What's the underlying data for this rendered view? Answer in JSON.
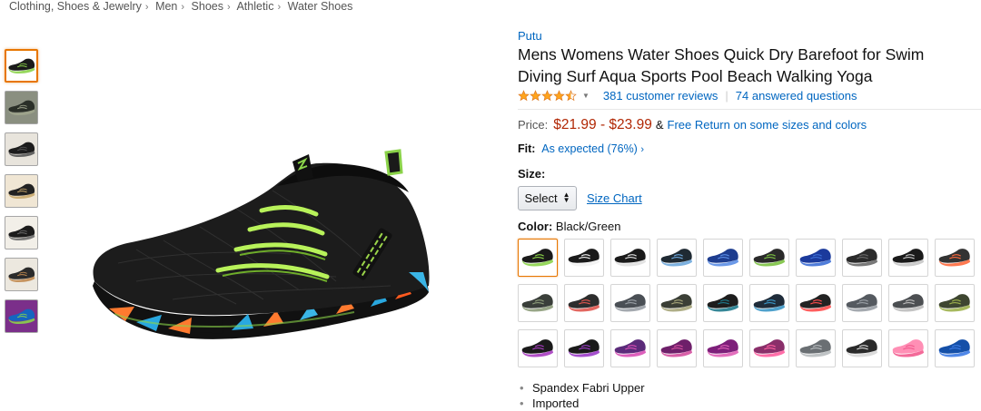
{
  "breadcrumb": [
    "Clothing, Shoes & Jewelry",
    "Men",
    "Shoes",
    "Athletic",
    "Water Shoes"
  ],
  "breadcrumb_separator": "›",
  "product": {
    "brand": "Putu",
    "title": "Mens Womens Water Shoes Quick Dry Barefoot for Swim Diving Surf Aqua Sports Pool Beach Walking Yoga",
    "rating": 4.5,
    "reviews_link": "381 customer reviews",
    "questions_link": "74 answered questions",
    "price_label": "Price:",
    "price_range": "$21.99 - $23.99",
    "amp": "&",
    "free_return": "Free Return on some sizes and colors",
    "fit_label": "Fit:",
    "fit_value": "As expected (76%)",
    "fit_caret": "›",
    "size_label": "Size:",
    "size_select": "Select",
    "size_chart": "Size Chart",
    "color_label": "Color:",
    "color_value": "Black/Green",
    "bullets": [
      "Spandex Fabri Upper",
      "Imported"
    ]
  },
  "colors": {
    "link": "#0066c0",
    "price": "#b12704",
    "selected_border": "#e77600",
    "star": "#ffa41c"
  },
  "thumbnails": [
    {
      "name": "black-green",
      "bg": "#ffffff",
      "shoe": "#1a1a1a",
      "accent": "#8bd34a"
    },
    {
      "name": "grey-scene",
      "bg": "#8a8f80",
      "shoe": "#2a2f28",
      "accent": "#9fa58c"
    },
    {
      "name": "pair",
      "bg": "#e8e4dc",
      "shoe": "#1c1c1c",
      "accent": "#555"
    },
    {
      "name": "features",
      "bg": "#f0e6d4",
      "shoe": "#222",
      "accent": "#c9a86c"
    },
    {
      "name": "detail",
      "bg": "#f2efe8",
      "shoe": "#1b1b1b",
      "accent": "#6c6c6c"
    },
    {
      "name": "sole",
      "bg": "#ece8df",
      "shoe": "#2b2b2b",
      "accent": "#c18a50"
    },
    {
      "name": "collage",
      "bg": "#7b2f8a",
      "shoe": "#1565c0",
      "accent": "#8bd34a"
    }
  ],
  "swatch_colors": [
    [
      "#1a1a1a",
      "#8bd34a"
    ],
    [
      "#1a1a1a",
      "#f2f2f2"
    ],
    [
      "#1a1a1a",
      "#e0e0e0"
    ],
    [
      "#1f2a33",
      "#6fa8dc"
    ],
    [
      "#1e3d8f",
      "#5b8ee6"
    ],
    [
      "#2a2a2a",
      "#7cc243"
    ],
    [
      "#1b3a9c",
      "#3d6fd6"
    ],
    [
      "#2b2b2b",
      "#6a6a6a"
    ],
    [
      "#1a1a1a",
      "#c7c7c7"
    ],
    [
      "#333333",
      "#ff6a3d"
    ],
    [
      "#3a3f3a",
      "#8d9c7a"
    ],
    [
      "#2d2d2d",
      "#e0574f"
    ],
    [
      "#4a4f55",
      "#9aa0a6"
    ],
    [
      "#3b3f36",
      "#a6a57a"
    ],
    [
      "#1d1d1d",
      "#1f7a8c"
    ],
    [
      "#1f2c3a",
      "#3c97c6"
    ],
    [
      "#222222",
      "#ff4d4d"
    ],
    [
      "#555a60",
      "#9aa0a6"
    ],
    [
      "#4c4f52",
      "#bcbcbc"
    ],
    [
      "#3e4630",
      "#9db14d"
    ],
    [
      "#1a1a1a",
      "#a73cc0"
    ],
    [
      "#1a1a1a",
      "#9b3cc8"
    ],
    [
      "#5b2b7a",
      "#d94fb5"
    ],
    [
      "#6e1f6a",
      "#d44f9e"
    ],
    [
      "#7d1f7a",
      "#e05fb6"
    ],
    [
      "#8a2f6a",
      "#ff5fa0"
    ],
    [
      "#6a6f73",
      "#b8bcbf"
    ],
    [
      "#2a2a2a",
      "#d8d8d8"
    ],
    [
      "#ff8fb5",
      "#f25a8e"
    ],
    [
      "#1550a8",
      "#3d7be6"
    ]
  ]
}
